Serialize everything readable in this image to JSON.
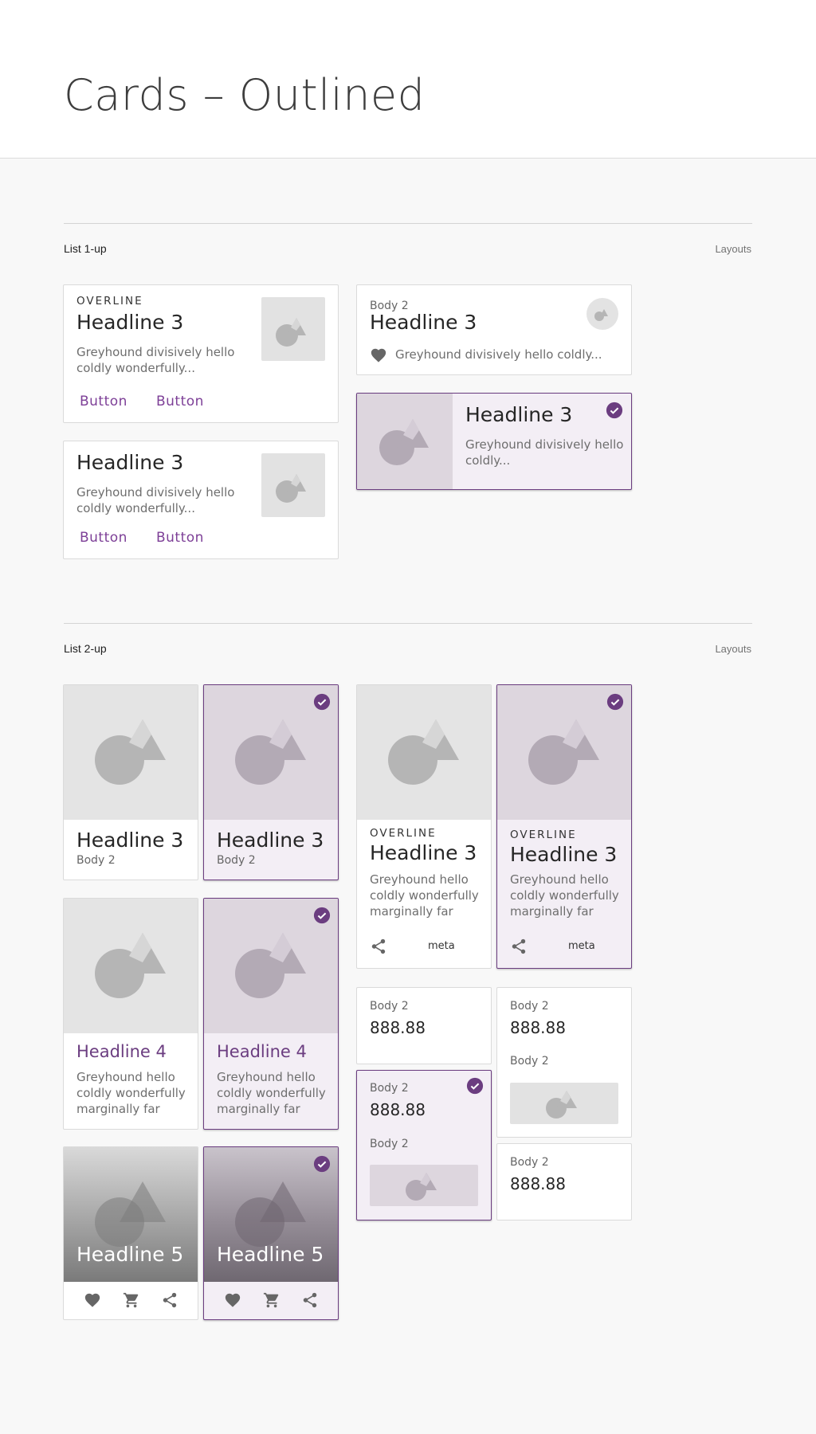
{
  "page": {
    "title": "Cards – Outlined"
  },
  "sections": {
    "list1": {
      "title": "List 1-up",
      "link": "Layouts"
    },
    "list2": {
      "title": "List 2-up",
      "link": "Layouts"
    }
  },
  "colors": {
    "accent": "#6b3d80",
    "selected_bg": "#f3eef5",
    "media_bg": "#e4e4e4"
  },
  "card1": {
    "overline": "OVERLINE",
    "headline": "Headline 3",
    "body": "Greyhound divisively hello coldly wonderfully...",
    "button1": "Button",
    "button2": "Button"
  },
  "card2": {
    "headline": "Headline 3",
    "body": "Greyhound divisively hello coldly wonderfully...",
    "button1": "Button",
    "button2": "Button"
  },
  "card3": {
    "subhead": "Body 2",
    "headline": "Headline 3",
    "body": "Greyhound divisively hello coldly...",
    "icon": "heart-icon"
  },
  "card4": {
    "headline": "Headline 3",
    "body": "Greyhound divisively hello coldly..."
  },
  "g1": {
    "headline": "Headline 3",
    "body": "Body 2"
  },
  "g2": {
    "headline": "Headline 3",
    "body": "Body 2"
  },
  "g3": {
    "headline": "Headline 4",
    "body": "Greyhound hello coldly wonderfully marginally far"
  },
  "g4": {
    "headline": "Headline 4",
    "body": "Greyhound hello coldly wonderfully marginally far"
  },
  "g5": {
    "headline": "Headline 5",
    "icons": [
      "heart-icon",
      "cart-icon",
      "share-icon"
    ]
  },
  "g6": {
    "headline": "Headline 5",
    "icons": [
      "heart-icon",
      "cart-icon",
      "share-icon"
    ]
  },
  "r1": {
    "overline": "OVERLINE",
    "headline": "Headline 3",
    "body": "Greyhound hello coldly wonderfully marginally far",
    "meta": "meta"
  },
  "r2": {
    "overline": "OVERLINE",
    "headline": "Headline 3",
    "body": "Greyhound hello coldly wonderfully marginally far",
    "meta": "meta"
  },
  "s1": {
    "label": "Body 2",
    "value": "888.88"
  },
  "s2": {
    "label": "Body 2",
    "value": "888.88",
    "label2": "Body 2"
  },
  "s3": {
    "label": "Body 2",
    "value": "888.88",
    "label2": "Body 2"
  },
  "s4": {
    "label": "Body 2",
    "value": "888.88"
  }
}
